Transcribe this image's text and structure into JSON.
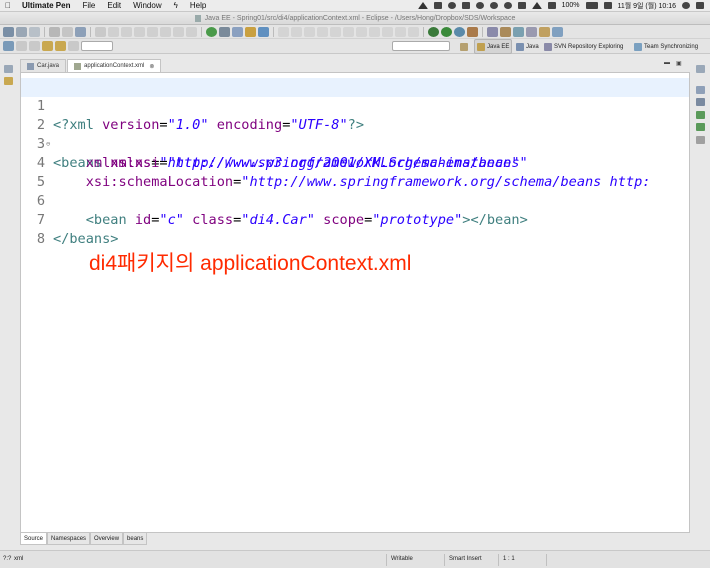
{
  "menubar": {
    "apple": "",
    "app_name": "Ultimate Pen",
    "items": [
      "File",
      "Edit",
      "Window"
    ],
    "help": "Help",
    "battery": "100%",
    "datetime": "11월 9일 (월)  10:16"
  },
  "window": {
    "title": "Java EE - Spring01/src/di4/applicationContext.xml - Eclipse - /Users/Hong/Dropbox/SDS/Workspace"
  },
  "perspectives": {
    "java_ee": "Java EE",
    "java": "Java",
    "svn": "SVN Repository Exploring",
    "team": "Team Synchronizing"
  },
  "editor": {
    "tabs": [
      {
        "label": "Car.java",
        "icon": "java-file-icon",
        "active": false
      },
      {
        "label": "applicationContext.xml",
        "icon": "xml-file-icon",
        "active": true,
        "close": "⊗"
      }
    ],
    "lines": [
      {
        "num": "1",
        "fold": ""
      },
      {
        "num": "2",
        "fold": "⊖"
      },
      {
        "num": "3",
        "fold": ""
      },
      {
        "num": "4",
        "fold": ""
      },
      {
        "num": "5",
        "fold": ""
      },
      {
        "num": "6",
        "fold": ""
      },
      {
        "num": "7",
        "fold": ""
      },
      {
        "num": "8",
        "fold": ""
      }
    ],
    "code": {
      "l1": {
        "open": "<?xml ",
        "a1": "version",
        "v1": "\"1.0\"",
        "a2": "encoding",
        "v2": "\"UTF-8\"",
        "close": "?>"
      },
      "l2": {
        "open": "<beans ",
        "a1": "xmlns",
        "v1": "\"http://www.springframework.org/schema/beans\""
      },
      "l3": {
        "indent": "    ",
        "a1": "xmlns:xsi",
        "v1": "\"http://www.w3.org/2001/XMLSchema-instance\""
      },
      "l4": {
        "indent": "    ",
        "a1": "xsi:schemaLocation",
        "v1": "\"http://www.springframework.org/schema/beans http:"
      },
      "l6": {
        "indent": "    ",
        "open": "<bean ",
        "a1": "id",
        "v1": "\"c\"",
        "a2": "class",
        "v2": "\"di4.Car\"",
        "a3": "scope",
        "v3": "\"prototype\"",
        "close": "></bean>"
      },
      "l7": {
        "text": "</beans>"
      }
    },
    "annotation": "di4패키지의 applicationContext.xml",
    "bottom_tabs": [
      "Source",
      "Namespaces",
      "Overview",
      "beans"
    ]
  },
  "statusbar": {
    "left_icon": "?:?",
    "left_label": "xml",
    "writable": "Writable",
    "insert_mode": "Smart Insert",
    "position": "1 : 1"
  },
  "colors": {
    "tag": "#3f7f7f",
    "attribute": "#7f007f",
    "value": "#2a00ff",
    "annotation": "#ff2a00",
    "current_line": "#e8f2fe"
  }
}
